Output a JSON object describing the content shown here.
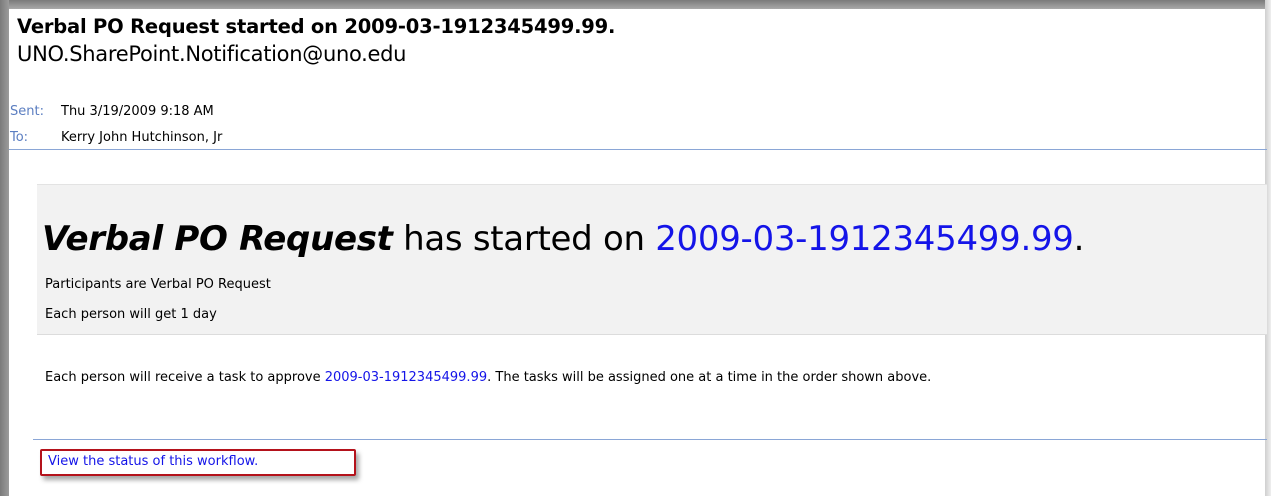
{
  "email": {
    "subject": "Verbal PO Request started on 2009-03-1912345499.99.",
    "from": "UNO.SharePoint.Notification@uno.edu",
    "sent_label": "Sent:",
    "sent_value": "Thu 3/19/2009 9:18 AM",
    "to_label": "To:",
    "to_value": "Kerry John Hutchinson, Jr"
  },
  "notice": {
    "workflow_name": "Verbal PO Request",
    "started_text": " has started on ",
    "item_name": "2009-03-1912345499.99",
    "period": ".",
    "participants": "Participants are Verbal PO Request",
    "duration": "Each person will get 1 day"
  },
  "body": {
    "text_before": "Each person will receive a task to approve ",
    "item_link": "2009-03-1912345499.99",
    "text_after": ". The tasks will be assigned one at a time in the order shown above."
  },
  "footer": {
    "status_link": "View the status of this workflow."
  },
  "colors": {
    "link": "#1414e8",
    "label": "#5b7ec1",
    "highlight_border": "#b4121b",
    "notice_background": "#f2f2f2"
  }
}
